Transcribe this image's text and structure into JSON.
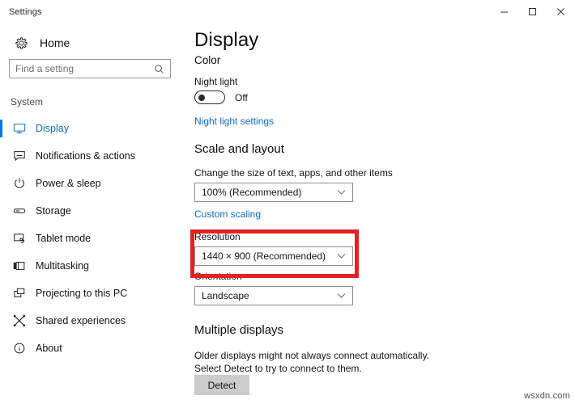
{
  "window": {
    "title": "Settings",
    "controls": [
      {
        "name": "minimize",
        "glyph": "minimize-icon"
      },
      {
        "name": "maximize",
        "glyph": "maximize-icon"
      },
      {
        "name": "close",
        "glyph": "close-icon"
      }
    ]
  },
  "sidebar": {
    "home_label": "Home",
    "home_icon": "gear-icon",
    "search": {
      "placeholder": "Find a setting",
      "value": "",
      "icon": "search-icon"
    },
    "group_header": "System",
    "items": [
      {
        "label": "Display",
        "icon": "monitor-icon",
        "selected": true
      },
      {
        "label": "Notifications & actions",
        "icon": "notification-bubble-icon",
        "selected": false
      },
      {
        "label": "Power & sleep",
        "icon": "power-icon",
        "selected": false
      },
      {
        "label": "Storage",
        "icon": "storage-drive-icon",
        "selected": false
      },
      {
        "label": "Tablet mode",
        "icon": "tablet-mode-icon",
        "selected": false
      },
      {
        "label": "Multitasking",
        "icon": "multitasking-icon",
        "selected": false
      },
      {
        "label": "Projecting to this PC",
        "icon": "projecting-icon",
        "selected": false
      },
      {
        "label": "Shared experiences",
        "icon": "shared-experiences-icon",
        "selected": false
      },
      {
        "label": "About",
        "icon": "info-circle-icon",
        "selected": false
      }
    ]
  },
  "main": {
    "page_title": "Display",
    "color_section": {
      "heading": "Color",
      "night_light_label": "Night light",
      "night_light_state": "Off",
      "night_light_on": false,
      "night_light_settings_link": "Night light settings"
    },
    "scale_section": {
      "heading": "Scale and layout",
      "scale_label": "Change the size of text, apps, and other items",
      "scale_value": "100% (Recommended)",
      "custom_scaling_link": "Custom scaling",
      "resolution_label": "Resolution",
      "resolution_value": "1440 × 900 (Recommended)",
      "orientation_label": "Orientation",
      "orientation_value": "Landscape"
    },
    "multiple_displays_section": {
      "heading": "Multiple displays",
      "description": "Older displays might not always connect automatically. Select Detect to try to connect to them.",
      "detect_button": "Detect"
    }
  },
  "annotation": {
    "highlight_color": "#e02222",
    "highlight_target": "Resolution"
  },
  "watermark": "wsxdn.com",
  "colors": {
    "accent": "#0078d7",
    "link": "#0f6cbd",
    "highlight_red": "#e02222",
    "background": "#ffffff"
  }
}
